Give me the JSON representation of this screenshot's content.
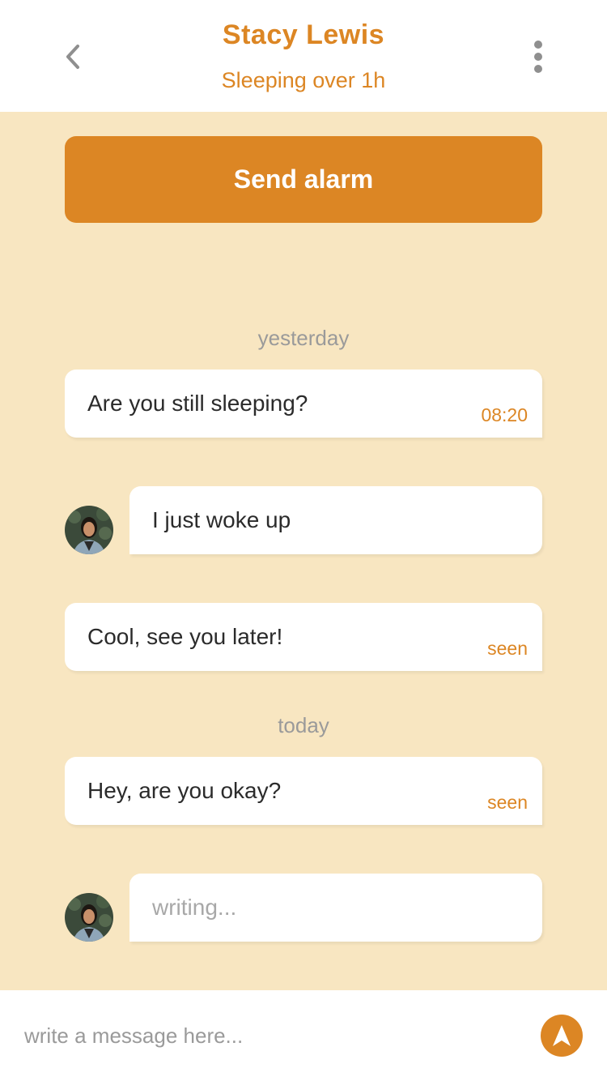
{
  "header": {
    "title": "Stacy Lewis",
    "status": "Sleeping over 1h",
    "back_icon": "chevron-left-icon",
    "menu_icon": "more-vertical-icon"
  },
  "alarm_button": {
    "label": "Send alarm"
  },
  "date_separators": [
    "yesterday",
    "today"
  ],
  "messages": [
    {
      "direction": "outgoing",
      "text": "Are you still sleeping?",
      "meta": "08:20"
    },
    {
      "direction": "incoming",
      "text": "I just woke up"
    },
    {
      "direction": "outgoing",
      "text": "Cool, see you later!",
      "meta": "seen"
    },
    {
      "direction": "outgoing",
      "text": "Hey, are you okay?",
      "meta": "seen"
    },
    {
      "direction": "incoming",
      "text": "writing...",
      "typing": true
    }
  ],
  "composer": {
    "placeholder": "write a message here...",
    "send_icon": "send-arrow-icon"
  },
  "colors": {
    "accent": "#dc8624",
    "background": "#f8e6c1",
    "bubble": "#ffffff",
    "muted": "#9a9a9a"
  }
}
